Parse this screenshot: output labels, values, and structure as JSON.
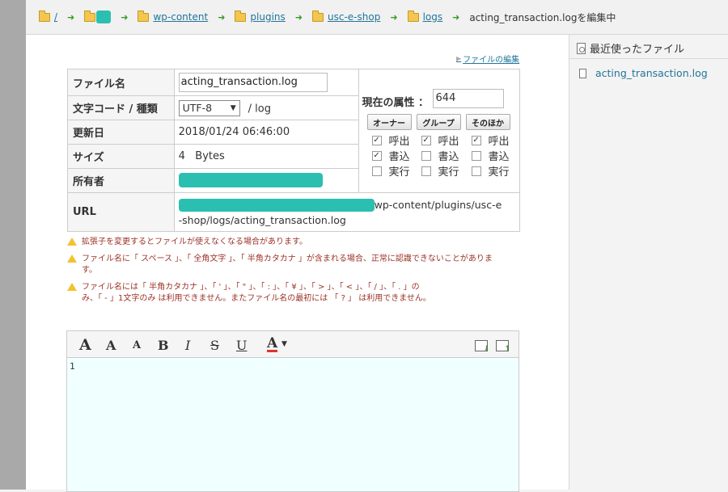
{
  "breadcrumb": {
    "root": "/",
    "items": [
      "wp-content",
      "plugins",
      "usc-e-shop",
      "logs"
    ],
    "current": "acting_transaction.logを編集中"
  },
  "edit_link": "ファイルの編集",
  "props": {
    "filename_label": "ファイル名",
    "filename_value": "acting_transaction.log",
    "encoding_label": "文字コード / 種類",
    "encoding_value": "UTF-8",
    "type_value": "/ log",
    "updated_label": "更新日",
    "updated_value": "2018/01/24 06:46:00",
    "size_label": "サイズ",
    "size_value": "4   Bytes",
    "owner_label": "所有者",
    "url_label": "URL",
    "url_line1": "wp-content/plugins/usc-e",
    "url_line2": "-shop/logs/acting_transaction.log"
  },
  "attributes": {
    "label": "現在の属性 ：",
    "value": "644",
    "headers": [
      "オーナー",
      "グループ",
      "そのほか"
    ],
    "rows": [
      "呼出",
      "書込",
      "実行"
    ],
    "checked": [
      [
        true,
        true,
        true
      ],
      [
        true,
        false,
        false
      ],
      [
        false,
        false,
        false
      ]
    ]
  },
  "warnings": [
    "拡張子を変更するとファイルが使えなくなる場合があります。",
    "ファイル名に「 スペース 」、「 全角文字 」、「 半角カタカナ 」が含まれる場合、正常に認識できないことがありま",
    "す。",
    "ファイル名には「 半角カタカナ 」、「 ' 」、「 \" 」、「 : 」、「 ¥ 」、「 > 」、「 < 」、「 / 」、「 . 」の",
    "み、「 - 」1文字のみ は利用できません。またファイル名の最初には 「 ? 」 は利用できません。"
  ],
  "toolbar": {
    "big_a": "A",
    "med_a": "A",
    "small_a": "A",
    "bold": "B",
    "italic": "I",
    "strike": "S",
    "underline": "U",
    "color": "A"
  },
  "editor": {
    "line_number": "1"
  },
  "sidebar": {
    "title": "最近使ったファイル",
    "files": [
      "acting_transaction.log"
    ]
  }
}
